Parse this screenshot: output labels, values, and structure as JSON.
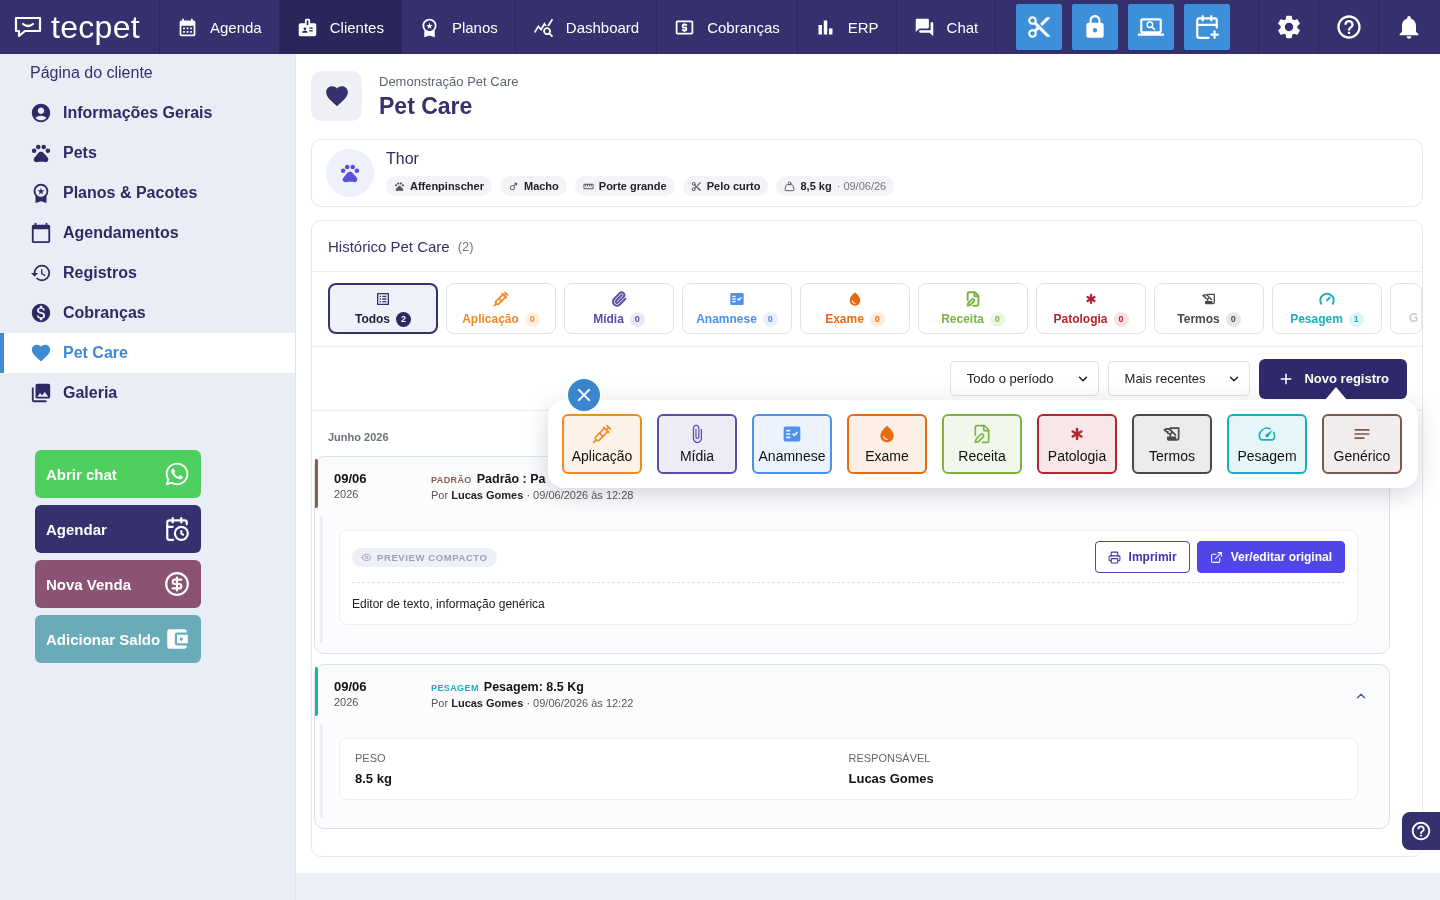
{
  "top_nav": {
    "logo": "tecpet",
    "items": [
      {
        "label": "Agenda",
        "selected": false
      },
      {
        "label": "Clientes",
        "selected": true
      },
      {
        "label": "Planos",
        "selected": false
      },
      {
        "label": "Dashboard",
        "selected": false
      },
      {
        "label": "Cobranças",
        "selected": false
      },
      {
        "label": "ERP",
        "selected": false
      },
      {
        "label": "Chat",
        "selected": false
      }
    ]
  },
  "sidebar": {
    "title": "Página do cliente",
    "items": [
      {
        "label": "Informações Gerais",
        "selected": false
      },
      {
        "label": "Pets",
        "selected": false
      },
      {
        "label": "Planos & Pacotes",
        "selected": false
      },
      {
        "label": "Agendamentos",
        "selected": false
      },
      {
        "label": "Registros",
        "selected": false
      },
      {
        "label": "Cobranças",
        "selected": false
      },
      {
        "label": "Pet Care",
        "selected": true
      },
      {
        "label": "Galeria",
        "selected": false
      }
    ],
    "actions": [
      {
        "label": "Abrir chat",
        "color": "#4fcf5e"
      },
      {
        "label": "Agendar",
        "color": "#35316e"
      },
      {
        "label": "Nova Venda",
        "color": "#8c5273"
      },
      {
        "label": "Adicionar Saldo",
        "color": "#6aabb9"
      }
    ]
  },
  "page_header": {
    "subtitle": "Demonstração Pet Care",
    "title": "Pet Care"
  },
  "pet": {
    "name": "Thor",
    "tags": [
      {
        "label": "Affenpinscher"
      },
      {
        "label": "Macho"
      },
      {
        "label": "Porte grande"
      },
      {
        "label": "Pelo curto"
      },
      {
        "label": "8,5 kg",
        "note": "· 09/06/26"
      }
    ]
  },
  "history": {
    "title": "Histórico Pet Care",
    "count": "(2)",
    "tabs": [
      {
        "kind": "full",
        "label": "Todos",
        "count": "2",
        "selected": true,
        "color": "#35316e"
      },
      {
        "kind": "full",
        "label": "Aplicação",
        "count": "0",
        "selected": false,
        "color": "#f08a24"
      },
      {
        "kind": "full",
        "label": "Mídia",
        "count": "0",
        "selected": false,
        "color": "#5a4fa8"
      },
      {
        "kind": "full",
        "label": "Anamnese",
        "count": "0",
        "selected": false,
        "color": "#4f8ff0"
      },
      {
        "kind": "full",
        "label": "Exame",
        "count": "0",
        "selected": false,
        "color": "#ea6a12"
      },
      {
        "kind": "full",
        "label": "Receita",
        "count": "0",
        "selected": false,
        "color": "#7cb342"
      },
      {
        "kind": "full",
        "label": "Patologia",
        "count": "0",
        "selected": false,
        "color": "#b3262d"
      },
      {
        "kind": "full",
        "label": "Termos",
        "count": "0",
        "selected": false,
        "color": "#4a4a4a"
      },
      {
        "kind": "full",
        "label": "Pesagem",
        "count": "1",
        "selected": false,
        "color": "#17b0bf"
      },
      {
        "kind": "clipped",
        "label": "G",
        "selected": false
      }
    ],
    "period_select": {
      "value": "Todo o período"
    },
    "sort_select": {
      "value": "Mais recentes"
    },
    "new_button": "Novo registro",
    "new_menu": {
      "items": [
        {
          "label": "Aplicação",
          "color": "#f08a24"
        },
        {
          "label": "Mídia",
          "color": "#5a4fa8"
        },
        {
          "label": "Anamnese",
          "color": "#4f8ff0"
        },
        {
          "label": "Exame",
          "color": "#ea6a12"
        },
        {
          "label": "Receita",
          "color": "#7cb342"
        },
        {
          "label": "Patologia",
          "color": "#b3262d"
        },
        {
          "label": "Termos",
          "color": "#4a4a4a"
        },
        {
          "label": "Pesagem",
          "color": "#17b0bf"
        },
        {
          "label": "Genérico",
          "color": "#7a5a4f"
        }
      ]
    },
    "group": "Junho 2026",
    "records": [
      {
        "kind": "preview",
        "color": "#8b5e4f",
        "date": "09/06",
        "year": "2026",
        "tag": "PADRÃO",
        "title": "Padrão : Pa",
        "meta": "Por **Lucas Gomes** · 09/06/2026 às 12:28",
        "preview": {
          "badge": "PREVIEW COMPACTO",
          "actions": [
            "Imprimir",
            "Ver/editar original"
          ],
          "text": "Editor de texto, informação genérica"
        }
      },
      {
        "kind": "fields",
        "color": "#17b0bf",
        "expanded": true,
        "date": "09/06",
        "year": "2026",
        "tag": "PESAGEM",
        "title": "Pesagem: 8.5 Kg",
        "meta": "Por **Lucas Gomes** · 09/06/2026 às 12:22",
        "fields": [
          {
            "label": "PESO",
            "value": "8.5 kg"
          },
          {
            "label": "RESPONSÁVEL",
            "value": "Lucas Gomes"
          }
        ]
      }
    ]
  }
}
